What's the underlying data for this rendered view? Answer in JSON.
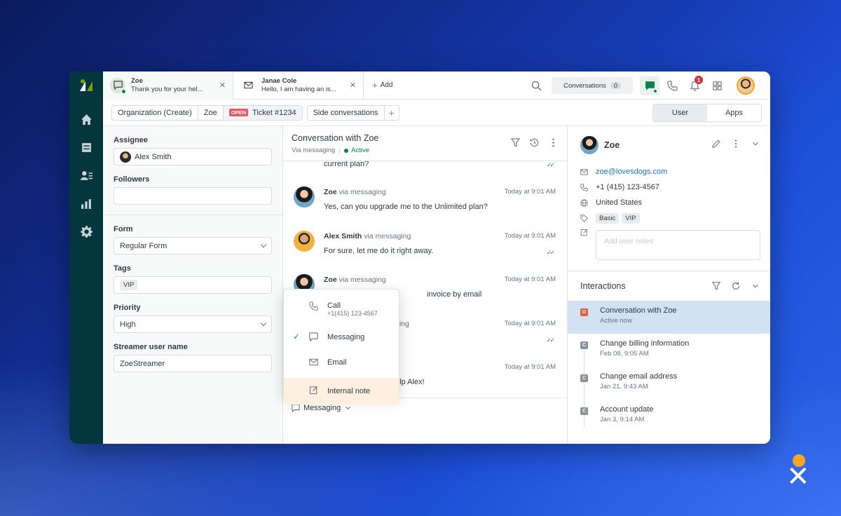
{
  "colors": {
    "rail": "#03363d",
    "accent": "#1f73b7",
    "active_green": "#038153",
    "badge_red": "#cc3340",
    "brand_orange": "#f5a623"
  },
  "rail": {
    "items": [
      "home-icon",
      "tickets-icon",
      "contacts-icon",
      "reports-icon",
      "settings-icon"
    ]
  },
  "tabs": [
    {
      "name": "Zoe",
      "preview": "Thank you for your hel...",
      "icon": "chat-icon"
    },
    {
      "name": "Janae Cole",
      "preview": "Hello, I am having an is...",
      "icon": "envelope-icon"
    }
  ],
  "add_tab_label": "Add",
  "conversations": {
    "label": "Conversations",
    "count": "0"
  },
  "notification_count": "1",
  "breadcrumb": {
    "org": "Organization (Create)",
    "user": "Zoe",
    "status": "OPEN",
    "ticket": "Ticket #1234",
    "side": "Side conversations"
  },
  "panel_toggle": {
    "user": "User",
    "apps": "Apps"
  },
  "ticket_fields": {
    "assignee_label": "Assignee",
    "assignee": "Alex Smith",
    "followers_label": "Followers",
    "form_label": "Form",
    "form": "Regular Form",
    "tags_label": "Tags",
    "tag": "VIP",
    "priority_label": "Priority",
    "priority": "High",
    "streamer_label": "Streamer user name",
    "streamer": "ZoeStreamer"
  },
  "conversation": {
    "title": "Conversation with Zoe",
    "channel": "Via messaging",
    "status": "Active",
    "partial_top": "current plan?",
    "messages": [
      {
        "name": "Zoe",
        "via": "via messaging",
        "time": "Today at 9:01 AM",
        "body": "Yes, can you upgrade me to the Unlimited plan?"
      },
      {
        "name": "Alex Smith",
        "via": "via messaging",
        "time": "Today at 9:01 AM",
        "body": "For sure, let me do it right away."
      },
      {
        "name": "Zoe",
        "via": "via messaging",
        "time": "Today at 9:01 AM",
        "body": "invoice by email"
      },
      {
        "name": "",
        "via": "ging",
        "time": "Today at 9:01 AM",
        "body": ""
      },
      {
        "name": "",
        "via": "",
        "time": "Today at 9:01 AM",
        "body": "elp Alex!"
      }
    ],
    "composer_mode": "Messaging"
  },
  "channel_menu": {
    "call_label": "Call",
    "call_number": "+1(415) 123-4567",
    "messaging_label": "Messaging",
    "email_label": "Email",
    "note_label": "Internal note"
  },
  "user_panel": {
    "name": "Zoe",
    "email": "zoe@lovesdogs.com",
    "phone": "+1 (415) 123-4567",
    "country": "United States",
    "tags": [
      "Basic",
      "VIP"
    ],
    "notes_placeholder": "Add user notes"
  },
  "interactions": {
    "title": "Interactions",
    "items": [
      {
        "badge": "O",
        "title": "Conversation with Zoe",
        "sub": "Active now"
      },
      {
        "badge": "C",
        "title": "Change billing information",
        "sub": "Feb 08, 9:05 AM"
      },
      {
        "badge": "C",
        "title": "Change email address",
        "sub": "Jan 21, 9:43 AM"
      },
      {
        "badge": "C",
        "title": "Account update",
        "sub": "Jan 3, 9:14 AM"
      }
    ]
  }
}
